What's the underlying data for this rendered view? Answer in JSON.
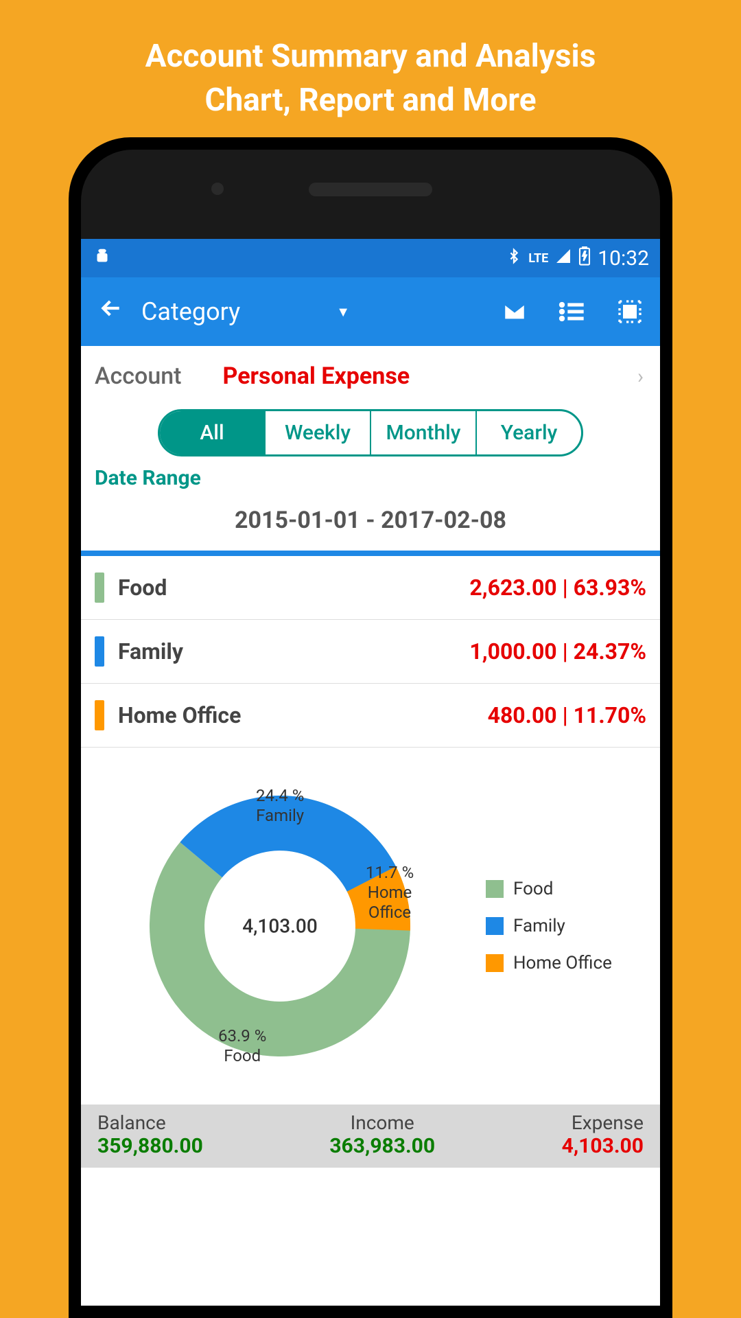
{
  "promo": {
    "line1": "Account Summary and Analysis",
    "line2": "Chart, Report and More"
  },
  "status": {
    "time": "10:32",
    "lte": "LTE"
  },
  "appbar": {
    "title": "Category"
  },
  "account": {
    "label": "Account",
    "value": "Personal Expense"
  },
  "periods": {
    "items": [
      "All",
      "Weekly",
      "Monthly",
      "Yearly"
    ],
    "active": 0
  },
  "date_range": {
    "label": "Date Range",
    "value": "2015-01-01 - 2017-02-08"
  },
  "categories": [
    {
      "name": "Food",
      "amount": "2,623.00",
      "pct": "63.93%",
      "color": "#8fbf8f"
    },
    {
      "name": "Family",
      "amount": "1,000.00",
      "pct": "24.37%",
      "color": "#1e88e5"
    },
    {
      "name": "Home Office",
      "amount": "480.00",
      "pct": "11.70%",
      "color": "#ff9800"
    }
  ],
  "chart_data": {
    "type": "pie",
    "title": "",
    "center_value": "4,103.00",
    "series": [
      {
        "name": "Food",
        "value": 2623.0,
        "pct": 63.9,
        "label": "63.9 %\nFood",
        "color": "#8fbf8f"
      },
      {
        "name": "Family",
        "value": 1000.0,
        "pct": 24.4,
        "label": "24.4 %\nFamily",
        "color": "#1e88e5"
      },
      {
        "name": "Home Office",
        "value": 480.0,
        "pct": 11.7,
        "label": "11.7 %\nHome Office",
        "color": "#ff9800"
      }
    ]
  },
  "legend": [
    "Food",
    "Family",
    "Home Office"
  ],
  "summary": {
    "balance_label": "Balance",
    "balance_value": "359,880.00",
    "income_label": "Income",
    "income_value": "363,983.00",
    "expense_label": "Expense",
    "expense_value": "4,103.00"
  }
}
